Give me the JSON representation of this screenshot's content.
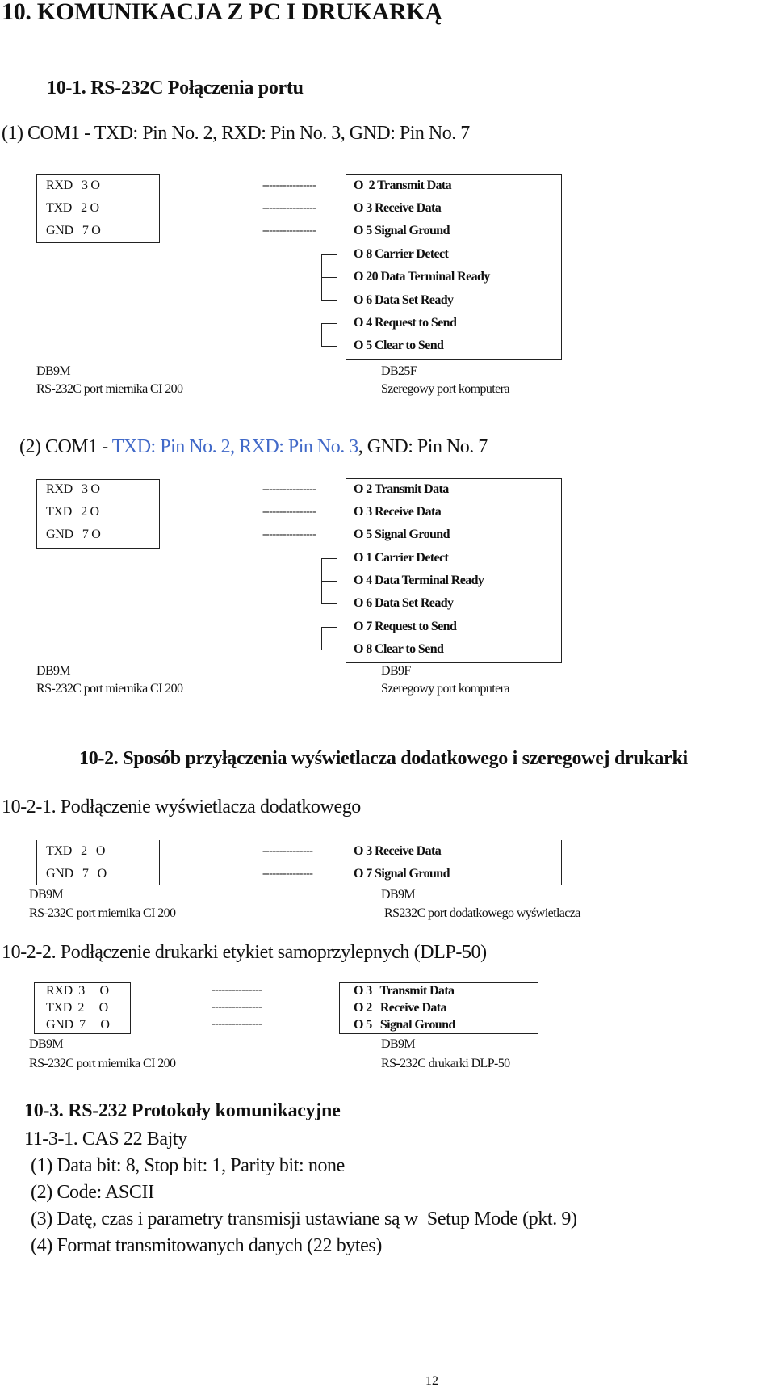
{
  "title": "10. KOMUNIKACJA Z PC I DRUKARKĄ",
  "section_10_1": {
    "heading": "10-1. RS-232C Połączenia portu",
    "diagram1": {
      "caption": "(1) COM1 - TXD: Pin No. 2, RXD: Pin No. 3, GND: Pin No. 7",
      "left_pins": [
        "RXD   3 O",
        "TXD   2 O",
        "GND   7 O"
      ],
      "dashes": "----------------",
      "right_pins": [
        "O  2 Transmit Data",
        "O 3 Receive Data",
        "O 5 Signal Ground",
        "O 8 Carrier Detect",
        "O 20 Data Terminal Ready",
        "O 6 Data Set Ready",
        "O 4 Request to Send",
        "O 5 Clear to Send"
      ],
      "left_connector": "DB9M",
      "left_desc": "RS-232C port miernika CI 200",
      "right_connector": "DB25F",
      "right_desc": "Szeregowy port komputera"
    },
    "diagram2": {
      "caption_prefix": "(2) COM1 - ",
      "caption_blue": "TXD: Pin No. 2, RXD: Pin No. 3",
      "caption_suffix": ", GND: Pin No. 7",
      "left_pins": [
        "RXD   3 O",
        "TXD   2 O",
        "GND   7 O"
      ],
      "dashes": "----------------",
      "right_pins": [
        "O 2 Transmit Data",
        "O 3 Receive Data",
        "O 5 Signal Ground",
        "O 1 Carrier Detect",
        "O 4 Data Terminal Ready",
        "O 6 Data Set Ready",
        "O 7 Request to Send",
        "O 8 Clear to Send"
      ],
      "left_connector": "DB9M",
      "left_desc": "RS-232C port miernika CI 200",
      "right_connector": "DB9F",
      "right_desc": "Szeregowy port komputera"
    },
    "accent_color": "#4169c8"
  },
  "section_10_2": {
    "heading": "10-2. Sposób przyłączenia wyświetlacza dodatkowego i szeregowej drukarki",
    "sub1": {
      "heading": "10-2-1. Podłączenie wyświetlacza dodatkowego",
      "left_pins": [
        "TXD   2   O",
        "GND   7   O"
      ],
      "dashes": "---------------",
      "right_pins": [
        "O 3 Receive Data",
        "O 7 Signal Ground"
      ],
      "left_connector": "DB9M",
      "left_desc": "RS-232C port miernika CI 200",
      "right_connector": "DB9M",
      "right_desc": "RS232C port dodatkowego wyświetlacza"
    },
    "sub2": {
      "heading": "10-2-2. Podłączenie drukarki etykiet samoprzylepnych (DLP-50)",
      "left_pins": [
        "RXD  3     O",
        "TXD  2     O",
        "GND  7     O"
      ],
      "dashes": "---------------",
      "right_pins": [
        "O 3   Transmit Data",
        "O 2   Receive Data",
        "O 5   Signal Ground"
      ],
      "left_connector": "DB9M",
      "left_desc": "RS-232C port miernika CI 200",
      "right_connector": "DB9M",
      "right_desc": "RS-232C drukarki DLP-50"
    }
  },
  "section_10_3": {
    "heading": "10-3. RS-232 Protokoły komunikacyjne",
    "sub_heading": "11-3-1. CAS 22 Bajty",
    "items": [
      "(1) Data bit: 8, Stop bit: 1, Parity bit: none",
      "(2) Code: ASCII",
      "(3) Datę, czas i parametry transmisji ustawiane są w  Setup Mode (pkt. 9)",
      "(4) Format transmitowanych danych (22 bytes)"
    ]
  },
  "page_number": "12"
}
